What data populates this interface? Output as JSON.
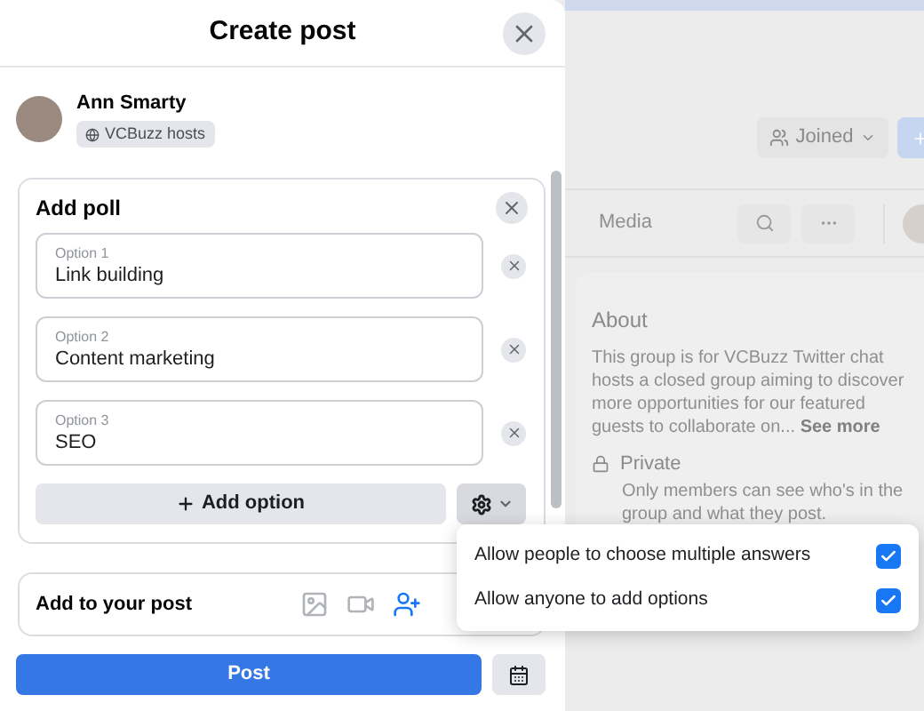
{
  "dialog": {
    "title": "Create post",
    "author": {
      "name": "Ann Smarty",
      "audience": "VCBuzz hosts"
    },
    "poll": {
      "title": "Add poll",
      "options": [
        {
          "label": "Option 1",
          "value": "Link building"
        },
        {
          "label": "Option 2",
          "value": "Content marketing"
        },
        {
          "label": "Option 3",
          "value": "SEO"
        }
      ],
      "add_option": "Add option"
    },
    "add_to_post": "Add to your post",
    "post_button": "Post"
  },
  "poll_settings_menu": [
    {
      "label": "Allow people to choose multiple answers",
      "checked": true
    },
    {
      "label": "Allow anyone to add options",
      "checked": true
    }
  ],
  "background": {
    "joined_button": "Joined",
    "tab": "Media",
    "about": {
      "title": "About",
      "description": "This group is for VCBuzz Twitter chat hosts a closed group aiming to discover more opportunities for our featured guests to collaborate on...",
      "see_more": "See more",
      "privacy": "Private",
      "privacy_description": "Only members can see who's in the group and what they post."
    }
  }
}
